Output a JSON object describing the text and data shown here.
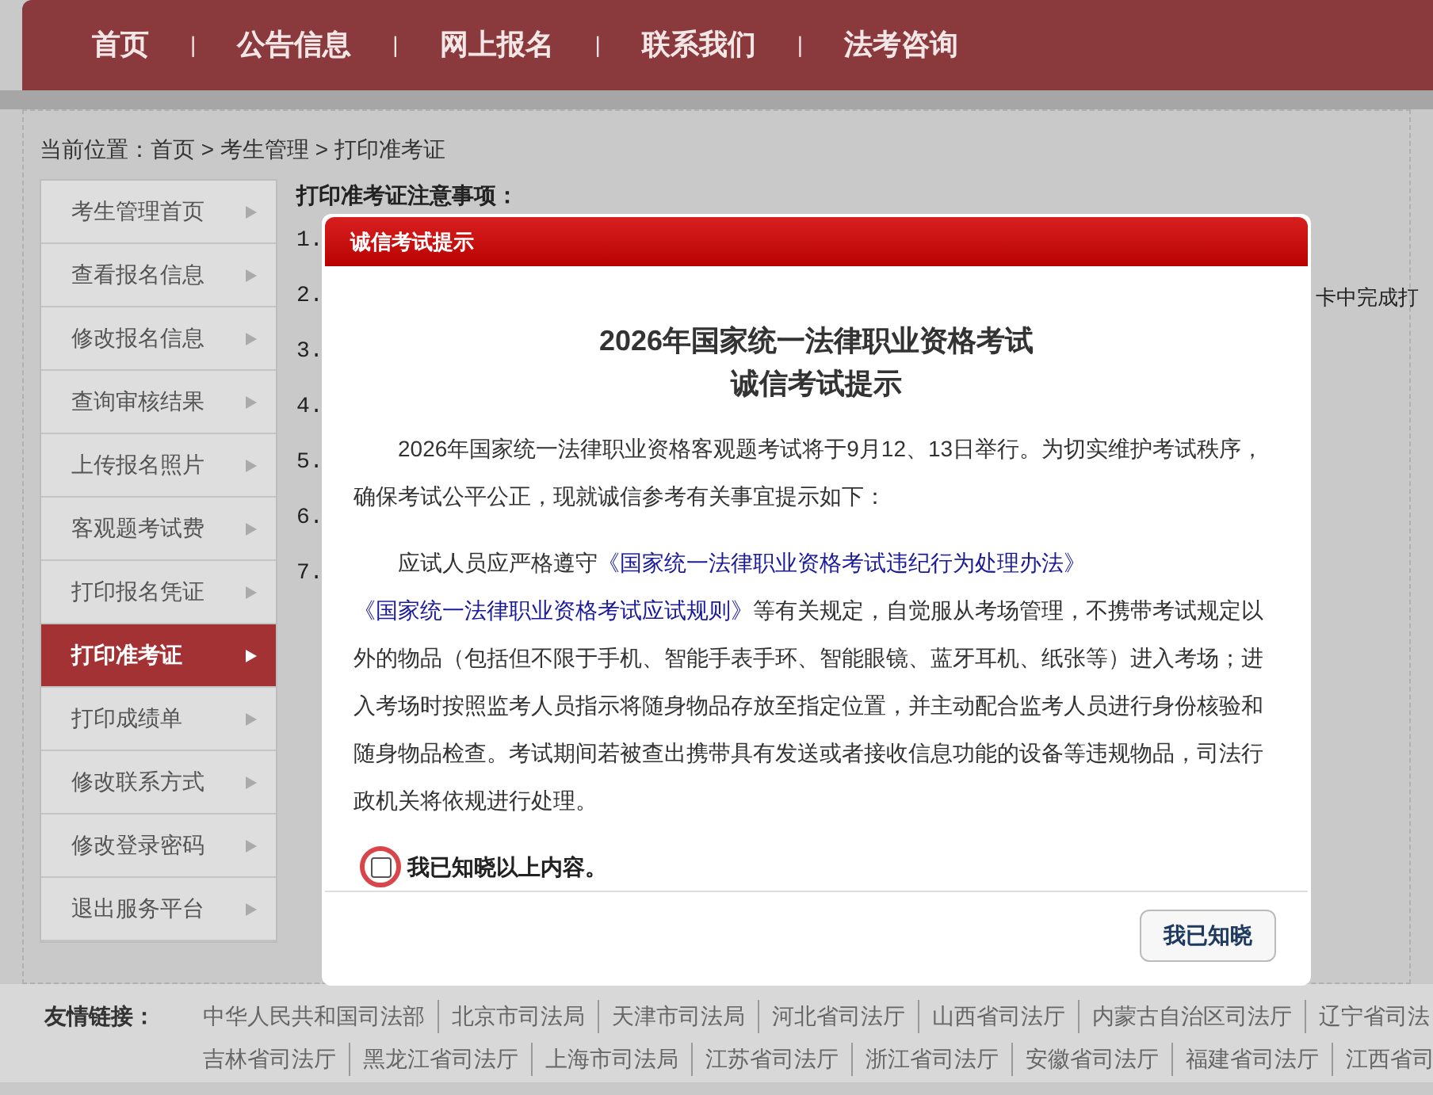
{
  "nav": {
    "items": [
      {
        "label": "首页"
      },
      {
        "label": "公告信息"
      },
      {
        "label": "网上报名"
      },
      {
        "label": "联系我们"
      },
      {
        "label": "法考咨询"
      }
    ],
    "separator": "|"
  },
  "breadcrumb": "当前位置：首页 > 考生管理 > 打印准考证",
  "sidebar": {
    "items": [
      {
        "label": "考生管理首页",
        "selected": false
      },
      {
        "label": "查看报名信息",
        "selected": false
      },
      {
        "label": "修改报名信息",
        "selected": false
      },
      {
        "label": "查询审核结果",
        "selected": false
      },
      {
        "label": "上传报名照片",
        "selected": false
      },
      {
        "label": "客观题考试费",
        "selected": false
      },
      {
        "label": "打印报名凭证",
        "selected": false
      },
      {
        "label": "打印准考证",
        "selected": true
      },
      {
        "label": "打印成绩单",
        "selected": false
      },
      {
        "label": "修改联系方式",
        "selected": false
      },
      {
        "label": "修改登录密码",
        "selected": false
      },
      {
        "label": "退出服务平台",
        "selected": false
      }
    ]
  },
  "content": {
    "heading": "打印准考证注意事项：",
    "items": [
      {
        "number": "1."
      },
      {
        "number": "2.",
        "tail": "卡中完成打"
      },
      {
        "number": "3."
      },
      {
        "number": "4."
      },
      {
        "number": "5."
      },
      {
        "number": "6."
      },
      {
        "number": "7."
      }
    ]
  },
  "dialog": {
    "title": "诚信考试提示",
    "heading_lines": [
      "2026年国家统一法律职业资格考试",
      "诚信考试提示"
    ],
    "paragraph_1": "2026年国家统一法律职业资格客观题考试将于9月12、13日举行。为切实维护考试秩序，确保考试公平公正，现就诚信参考有关事宜提示如下：",
    "paragraph_2": {
      "before": "应试人员应严格遵守",
      "links": [
        "《国家统一法律职业资格考试违纪行为处理办法》",
        "《国家统一法律职业资格考试应试规则》"
      ],
      "after": "等有关规定，自觉服从考场管理，不携带考试规定以外的物品（包括但不限于手机、智能手表手环、智能眼镜、蓝牙耳机、纸张等）进入考场；进入考场时按照监考人员指示将随身物品存放至指定位置，并主动配合监考人员进行身份核验和随身物品检查。考试期间若被查出携带具有发送或者接收信息功能的设备等违规物品，司法行政机关将依规进行处理。"
    },
    "checkbox": {
      "label": "我已知晓以上内容。",
      "checked": false,
      "highlighted": true
    },
    "button": "我已知晓"
  },
  "footer": {
    "title": "友情链接：",
    "lines": [
      {
        "links": [
          "中华人民共和国司法部",
          "北京市司法局",
          "天津市司法局",
          "河北省司法厅",
          "山西省司法厅",
          "内蒙古自治区司法厅",
          "辽宁省司法"
        ]
      },
      {
        "links": [
          "吉林省司法厅",
          "黑龙江省司法厅",
          "上海市司法局",
          "江苏省司法厅",
          "浙江省司法厅",
          "安徽省司法厅",
          "福建省司法厅",
          "江西省司"
        ]
      }
    ]
  }
}
